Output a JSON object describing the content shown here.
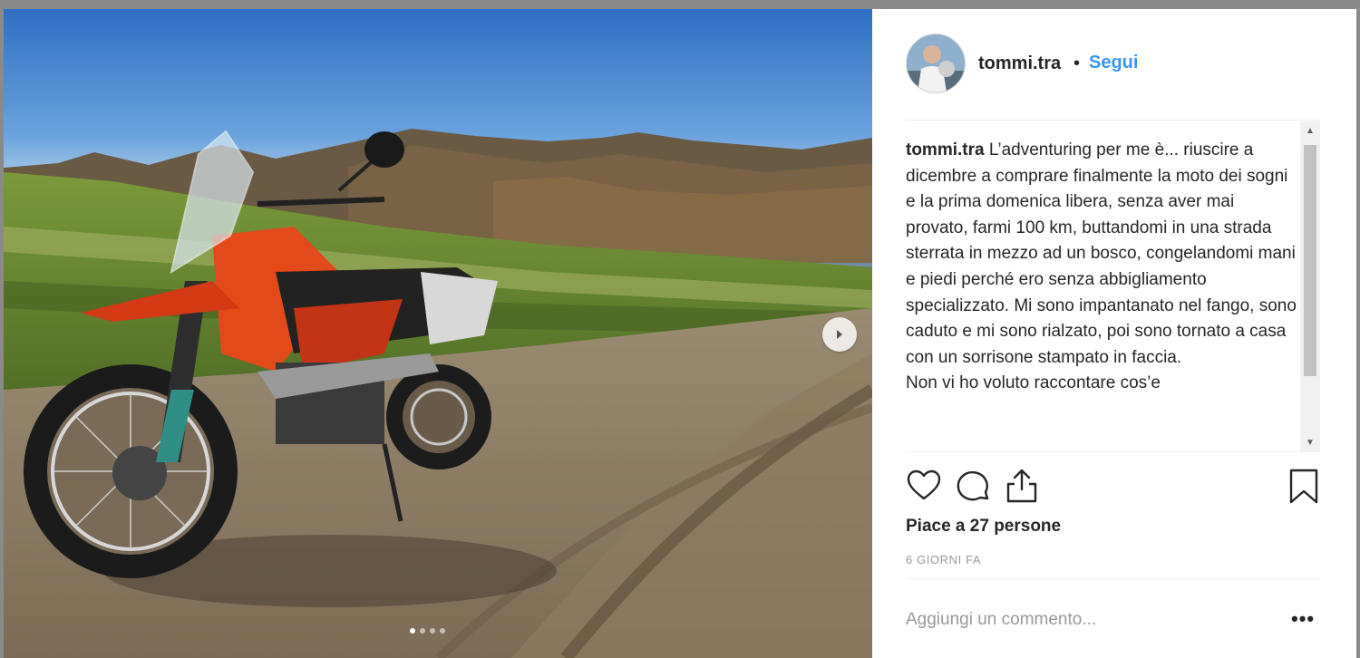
{
  "post": {
    "username": "tommi.tra",
    "separator": "•",
    "follow_label": "Segui",
    "caption_paragraphs": [
      "L’adventuring per me è... riuscire a dicembre a comprare finalmente la moto dei sogni e la prima domenica libera, senza aver mai provato, farmi 100 km, buttandomi in una strada sterrata in mezzo ad un bosco, congelandomi mani e piedi perché ero senza abbigliamento specializzato. Mi sono impantanato nel fango, sono caduto e mi sono rialzato, poi sono tornato a casa con un sorrisone stampato in faccia.",
      "Non vi ho voluto raccontare cos’e"
    ],
    "likes_text": "Piace a 27 persone",
    "timestamp": "6 GIORNI FA",
    "comment_placeholder": "Aggiungi un commento...",
    "more_label": "•••",
    "carousel": {
      "count": 4,
      "active_index": 0
    }
  },
  "icons": {
    "like": "heart-icon",
    "comment": "comment-bubble-icon",
    "share": "share-upload-icon",
    "save": "bookmark-icon",
    "next": "chevron-right-icon"
  },
  "colors": {
    "accent": "#3897f0",
    "text": "#262626",
    "muted": "#999999"
  }
}
